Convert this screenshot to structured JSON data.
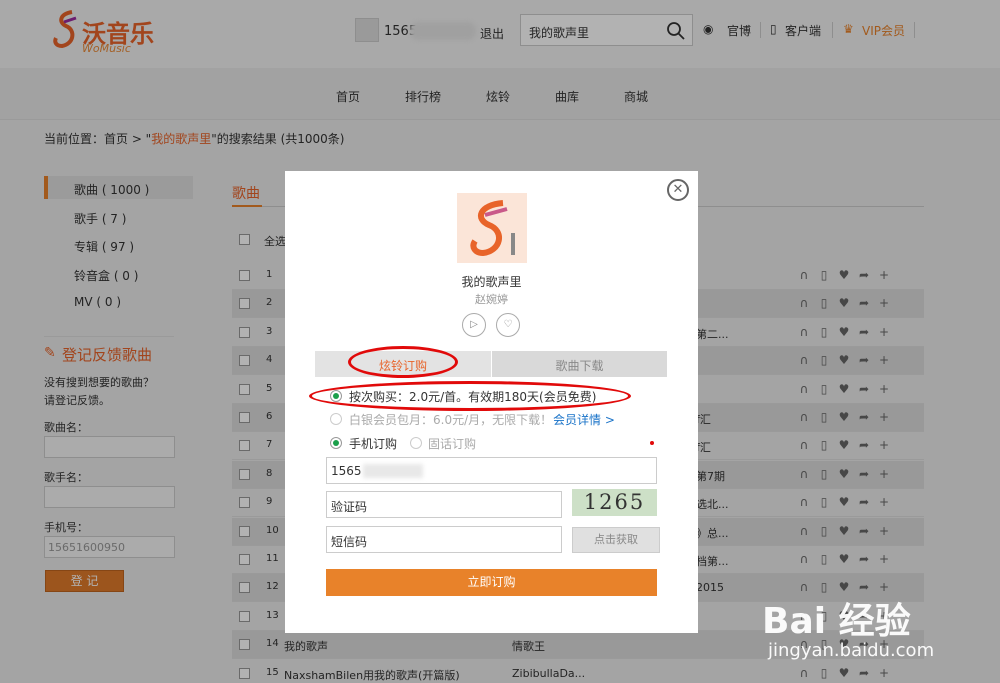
{
  "header": {
    "logo_cn": "沃音乐",
    "logo_en": "WoMusic",
    "username": "1565",
    "logout": "退出",
    "search_value": "我的歌声里",
    "weibo": "官博",
    "client": "客户端",
    "vip": "VIP会员"
  },
  "nav": [
    "首页",
    "排行榜",
    "炫铃",
    "曲库",
    "商城"
  ],
  "breadcrumb": {
    "prefix": "当前位置：首页 > \"",
    "keyword": "我的歌声里",
    "suffix": "\"的搜索结果 (共1000条)"
  },
  "left_menu": [
    "歌曲 ( 1000 )",
    "歌手 ( 7 )",
    "专辑 ( 97 )",
    "铃音盒 ( 0 )",
    "MV ( 0 )"
  ],
  "feedback": {
    "title": "登记反馈歌曲",
    "desc1": "没有搜到想要的歌曲？",
    "desc2": "请登记反馈。",
    "song_label": "歌曲名：",
    "singer_label": "歌手名：",
    "phone_label": "手机号：",
    "phone_value": "15651600950",
    "submit": "登 记"
  },
  "songs": {
    "title": "歌曲",
    "select_all": "全选",
    "rows": [
      {
        "n": "1",
        "title": "",
        "artist": "",
        "extra": ""
      },
      {
        "n": "2",
        "title": "",
        "artist": "",
        "extra": ""
      },
      {
        "n": "3",
        "title": "",
        "artist": "",
        "extra": "第二..."
      },
      {
        "n": "4",
        "title": "",
        "artist": "",
        "extra": ""
      },
      {
        "n": "5",
        "title": "",
        "artist": "",
        "extra": ""
      },
      {
        "n": "6",
        "title": "",
        "artist": "",
        "extra": "f汇"
      },
      {
        "n": "7",
        "title": "",
        "artist": "",
        "extra": "f汇"
      },
      {
        "n": "8",
        "title": "",
        "artist": "",
        "extra": "第7期"
      },
      {
        "n": "9",
        "title": "",
        "artist": "",
        "extra": "选北..."
      },
      {
        "n": "10",
        "title": "",
        "artist": "",
        "extra": "》总..."
      },
      {
        "n": "11",
        "title": "",
        "artist": "",
        "extra": "档第..."
      },
      {
        "n": "12",
        "title": "",
        "artist": "",
        "extra": "2015"
      },
      {
        "n": "13",
        "title": "",
        "artist": "",
        "extra": ""
      },
      {
        "n": "14",
        "title": "我的歌声",
        "artist": "情歌王",
        "extra": ""
      },
      {
        "n": "15",
        "title": "NaxshamBilen用我的歌声(开篇版)",
        "artist": "ZibibullaDa...",
        "extra": ""
      }
    ]
  },
  "modal": {
    "song_title": "我的歌声里",
    "singer": "赵婉婷",
    "play_icon": "play-icon",
    "like_icon": "heart-icon",
    "tab_ring": "炫铃订购",
    "tab_download": "歌曲下载",
    "option1": "按次购买：2.0元/首。有效期180天(会员免费)",
    "option2_prefix": "白银会员包月：6.0元/月，无限下载！",
    "option2_link": "会员详情 >",
    "mobile_label": "手机订购",
    "fixed_label": "固话订购",
    "mobile_value": "1565",
    "captcha_placeholder": "验证码",
    "captcha_text": "1265",
    "sms_placeholder": "短信码",
    "sms_btn": "点击获取",
    "buy_btn": "立即订购"
  },
  "watermark": {
    "logo": "Bai 经验",
    "url": "jingyan.baidu.com"
  },
  "colors": {
    "accent": "#e8822a",
    "highlight_red": "#e10a0a",
    "radio_green": "#1ca04b",
    "link_blue": "#1a73c8"
  }
}
